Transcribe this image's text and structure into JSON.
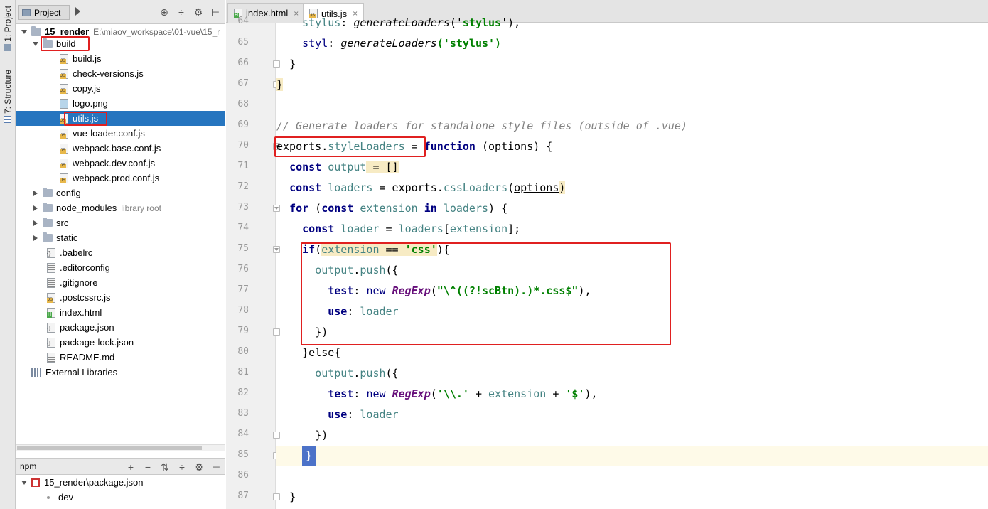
{
  "toolstrip": {
    "project_tab": "1: Project",
    "structure_tab": "7: Structure"
  },
  "project": {
    "tab_label": "Project",
    "tree": [
      {
        "label": "15_render",
        "path": "E:\\miaov_workspace\\01-vue\\15_r",
        "kind": "module"
      },
      {
        "label": "build",
        "kind": "folder"
      },
      {
        "label": "build.js",
        "kind": "js"
      },
      {
        "label": "check-versions.js",
        "kind": "js"
      },
      {
        "label": "copy.js",
        "kind": "js"
      },
      {
        "label": "logo.png",
        "kind": "png"
      },
      {
        "label": "utils.js",
        "kind": "js"
      },
      {
        "label": "vue-loader.conf.js",
        "kind": "js"
      },
      {
        "label": "webpack.base.conf.js",
        "kind": "js"
      },
      {
        "label": "webpack.dev.conf.js",
        "kind": "js"
      },
      {
        "label": "webpack.prod.conf.js",
        "kind": "js"
      },
      {
        "label": "config",
        "kind": "folder"
      },
      {
        "label": "node_modules",
        "hint": "library root",
        "kind": "folder"
      },
      {
        "label": "src",
        "kind": "folder"
      },
      {
        "label": "static",
        "kind": "folder"
      },
      {
        "label": ".babelrc",
        "kind": "json"
      },
      {
        "label": ".editorconfig",
        "kind": "txt"
      },
      {
        "label": ".gitignore",
        "kind": "txt"
      },
      {
        "label": ".postcssrc.js",
        "kind": "js"
      },
      {
        "label": "index.html",
        "kind": "html"
      },
      {
        "label": "package.json",
        "kind": "json"
      },
      {
        "label": "package-lock.json",
        "kind": "json"
      },
      {
        "label": "README.md",
        "kind": "txt"
      },
      {
        "label": "External Libraries",
        "kind": "lib"
      }
    ]
  },
  "npm": {
    "title": "npm",
    "package": "15_render\\package.json",
    "script": "dev"
  },
  "editor": {
    "tabs": [
      {
        "label": "index.html"
      },
      {
        "label": "utils.js"
      }
    ],
    "line_numbers": [
      "64",
      "65",
      "66",
      "67",
      "68",
      "69",
      "70",
      "71",
      "72",
      "73",
      "74",
      "75",
      "76",
      "77",
      "78",
      "79",
      "80",
      "81",
      "82",
      "83",
      "84",
      "85",
      "86",
      "87"
    ],
    "code": {
      "l64a": "stylus",
      "l64b": ": ",
      "l64c": "generateLoaders",
      "l64d": "('",
      "l64e": "stylus",
      "l64f": "'),",
      "l65a": "styl",
      "l65b": ": ",
      "l65c": "generateLoaders",
      "l65d": "('stylus')",
      "l66": "}",
      "l67": "}",
      "l69": "// Generate loaders for standalone style files (outside of .vue)",
      "l70a": "exports",
      "l70b": ".",
      "l70c": "styleLoaders",
      "l70d": " = ",
      "l70e": "function",
      "l70f": " (",
      "l70g": "options",
      "l70h": ") {",
      "l71a": "const",
      "l71b": "output",
      "l71c": " = []",
      "l72a": "const",
      "l72b": "loaders",
      "l72c": " = exports.",
      "l72d": "cssLoaders",
      "l72e": "(",
      "l72f": "options",
      "l72g": ")",
      "l73a": "for",
      "l73b": " (",
      "l73c": "const",
      "l73d": "extension",
      "l73e": "in",
      "l73f": "loaders",
      "l73g": ") {",
      "l74a": "const",
      "l74b": "loader",
      "l74c": " = ",
      "l74d": "loaders",
      "l74e": "[",
      "l74f": "extension",
      "l74g": "];",
      "l75a": "if",
      "l75b": "(",
      "l75c": "extension",
      "l75d": " == ",
      "l75e": "'css'",
      "l75f": "){",
      "l76a": "output",
      "l76b": ".",
      "l76c": "push",
      "l76d": "({",
      "l77a": "test",
      "l77b": ": ",
      "l77c": "new",
      "l77d": "RegExp",
      "l77e": "(",
      "l77f": "\"\\^((?!scBtn).)*.css$\"",
      "l77g": "),",
      "l78a": "use",
      "l78b": ": ",
      "l78c": "loader",
      "l79": "})",
      "l80": "}else{",
      "l81a": "output",
      "l81b": ".",
      "l81c": "push",
      "l81d": "({",
      "l82a": "test",
      "l82b": ": ",
      "l82c": "new",
      "l82d": "RegExp",
      "l82e": "(",
      "l82f": "'\\\\.'",
      "l82g": " + ",
      "l82h": "extension",
      "l82i": " + ",
      "l82j": "'$'",
      "l82k": "),",
      "l83a": "use",
      "l83b": ": ",
      "l83c": "loader",
      "l84": "})",
      "l85": "}",
      "l87": "}"
    }
  },
  "colors": {
    "selection": "#2675bf",
    "annotation_box": "#e02020",
    "keyword": "#000080",
    "string": "#008000",
    "comment": "#808080"
  }
}
